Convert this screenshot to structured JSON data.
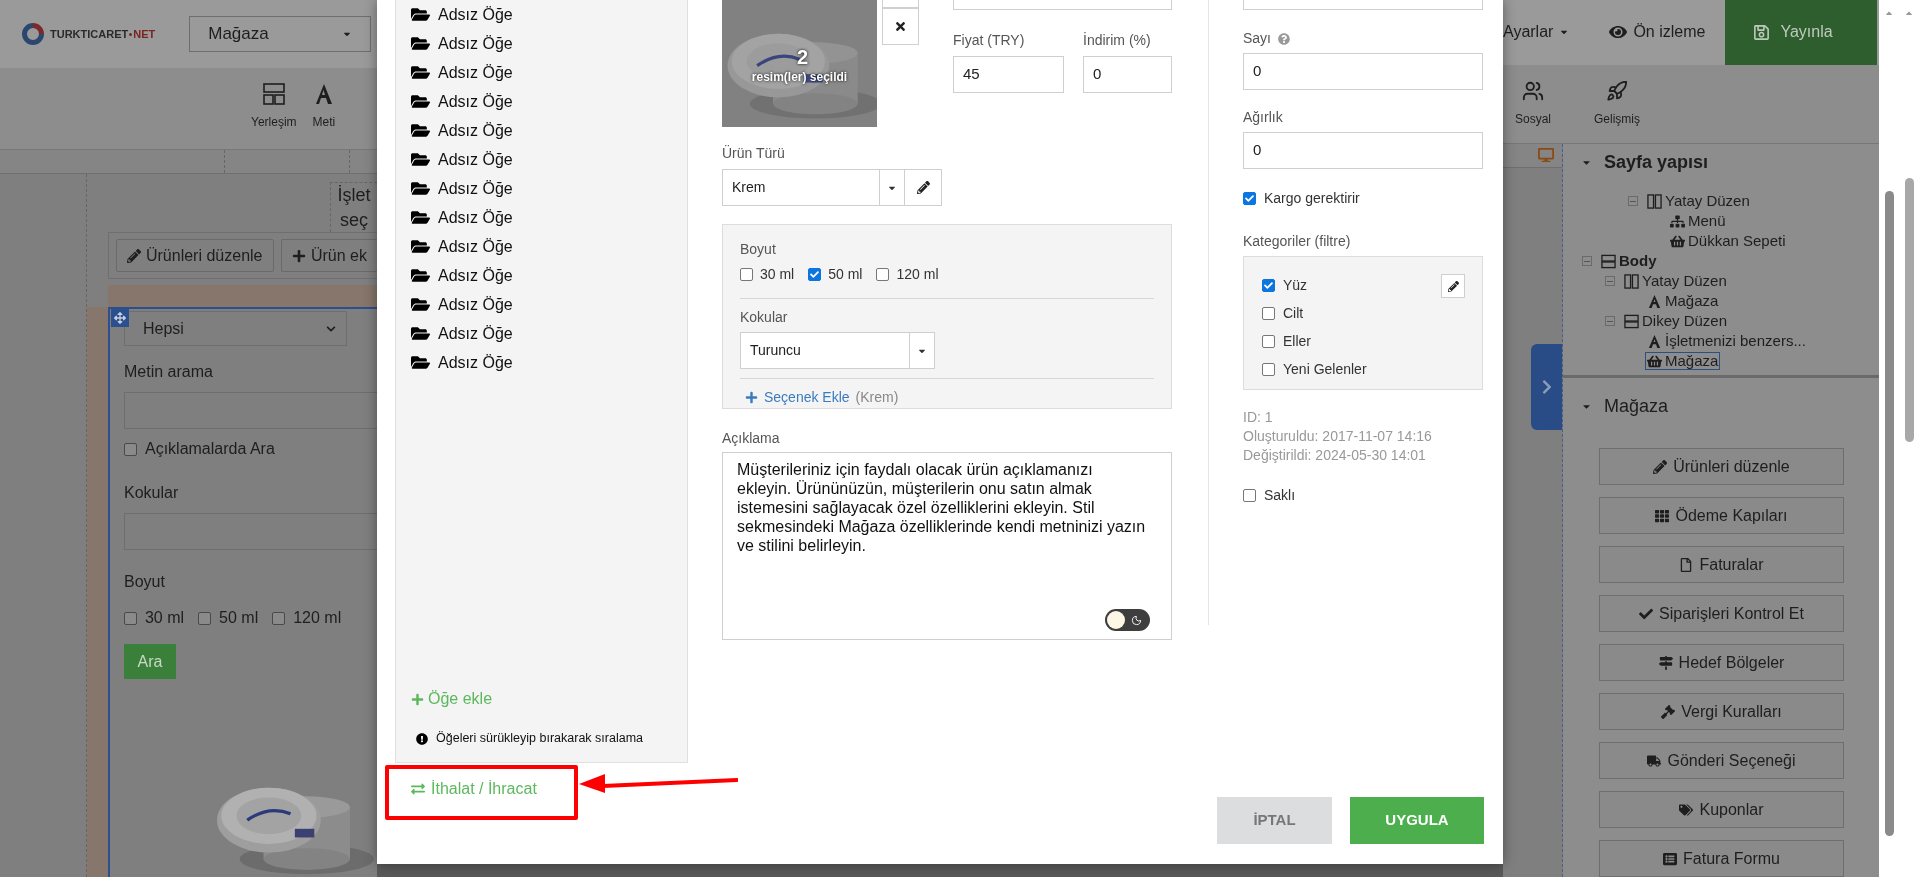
{
  "top_bar": {
    "logo_name": "TURKTICARET",
    "logo_suffix": "NET",
    "page_select": "Mağaza",
    "actions": [
      {
        "label": "Ayarlar",
        "kind": "dropdown"
      },
      {
        "label": "Ön izleme",
        "kind": "preview"
      },
      {
        "label": "Yayınla",
        "kind": "publish"
      }
    ]
  },
  "toolbar_left": [
    {
      "label": "Yerleşim",
      "kind": "layout"
    },
    {
      "label": "Meti",
      "kind": "text"
    }
  ],
  "toolbar_right": [
    {
      "label": "Sosyal",
      "kind": "social"
    },
    {
      "label": "Gelişmiş",
      "kind": "advanced"
    }
  ],
  "canvas": {
    "text_block": [
      "İşlet",
      "seç"
    ],
    "buttons": [
      {
        "label": "Ürünleri düzenle",
        "kind": "edit"
      },
      {
        "label": "Ürün ek",
        "kind": "add"
      }
    ],
    "filter": {
      "category": "Hepsi",
      "search_label": "Metin arama",
      "search_in_descriptions": {
        "label": "Açıklamalarda Ara",
        "checked": false
      },
      "scent_label": "Kokular",
      "size_label": "Boyut",
      "sizes": [
        {
          "label": "30 ml",
          "checked": false
        },
        {
          "label": "50 ml",
          "checked": false
        },
        {
          "label": "120 ml",
          "checked": false
        }
      ],
      "submit": "Ara"
    }
  },
  "modal": {
    "items": [
      {
        "label": "Adsız Öğe"
      },
      {
        "label": "Adsız Öğe"
      },
      {
        "label": "Adsız Öğe"
      },
      {
        "label": "Adsız Öğe"
      },
      {
        "label": "Adsız Öğe"
      },
      {
        "label": "Adsız Öğe"
      },
      {
        "label": "Adsız Öğe"
      },
      {
        "label": "Adsız Öğe"
      },
      {
        "label": "Adsız Öğe"
      },
      {
        "label": "Adsız Öğe"
      },
      {
        "label": "Adsız Öğe"
      },
      {
        "label": "Adsız Öğe"
      },
      {
        "label": "Adsız Öğe"
      }
    ],
    "add_item": "Öğe ekle",
    "sort_hint": "Öğeleri sürükleyip bırakarak sıralama",
    "import_export": "İthalat / İhracat",
    "image": {
      "count": "2",
      "caption": "resim(ler) seçildi"
    },
    "price": {
      "label": "Fiyat (TRY)",
      "value": "45"
    },
    "discount": {
      "label": "İndirim (%)",
      "value": "0"
    },
    "product_type": {
      "label": "Ürün Türü",
      "value": "Krem"
    },
    "options": {
      "size_label": "Boyut",
      "sizes": [
        {
          "label": "30 ml",
          "checked": false
        },
        {
          "label": "50 ml",
          "checked": true
        },
        {
          "label": "120 ml",
          "checked": false
        }
      ],
      "scent_label": "Kokular",
      "scent_value": "Turuncu",
      "add_option": "Seçenek Ekle",
      "add_option_note": "(Krem)"
    },
    "description": {
      "label": "Açıklama",
      "value": "Müşterileriniz için faydalı olacak ürün açıklamanızı ekleyin. Ürününüzün, müşterilerin onu satın almak istemesini sağlayacak özel özelliklerini ekleyin. Stil sekmesindeki Mağaza özelliklerinde kendi metninizi yazın ve stilini belirleyin.",
      "dark_mode": false
    },
    "count": {
      "label": "Sayı",
      "value": "0"
    },
    "weight": {
      "label": "Ağırlık",
      "value": "0"
    },
    "shipping_required": {
      "label": "Kargo gerektirir",
      "checked": true
    },
    "categories": {
      "label": "Kategoriler (filtre)",
      "items": [
        {
          "label": "Yüz",
          "checked": true
        },
        {
          "label": "Cilt",
          "checked": false
        },
        {
          "label": "Eller",
          "checked": false
        },
        {
          "label": "Yeni Gelenler",
          "checked": false
        }
      ]
    },
    "meta": [
      "ID: 1",
      "Oluşturuldu: 2017-11-07 14:16",
      "Değiştirildi: 2024-05-30 14:01"
    ],
    "hidden": {
      "label": "Saklı",
      "checked": false
    },
    "buttons": [
      {
        "label": "İPTAL",
        "kind": "cancel"
      },
      {
        "label": "UYGULA",
        "kind": "apply"
      }
    ]
  },
  "sidebar": {
    "structure_title": "Sayfa yapısı",
    "tree_partial": [
      {
        "label": "Yatay Düzen",
        "kind": "columns",
        "expanded": true,
        "selected": false,
        "children": [
          {
            "label": "Menü",
            "kind": "sitemap",
            "selected": false
          },
          {
            "label": "Dükkan Sepeti",
            "kind": "basket",
            "selected": false
          }
        ]
      }
    ],
    "tree": [
      {
        "label": "Body",
        "kind": "rows",
        "expanded": true,
        "selected": false,
        "children": [
          {
            "label": "Yatay Düzen",
            "kind": "columns",
            "expanded": true,
            "selected": false,
            "children": [
              {
                "label": "Mağaza",
                "kind": "text",
                "selected": false
              }
            ]
          },
          {
            "label": "Dikey Düzen",
            "kind": "rows",
            "expanded": true,
            "selected": false,
            "children": [
              {
                "label": "İşletmenizi benzers...",
                "kind": "text",
                "selected": false
              },
              {
                "label": "Mağaza",
                "kind": "basket",
                "selected": true
              }
            ]
          }
        ]
      }
    ],
    "store_title": "Mağaza",
    "store_buttons": [
      {
        "label": "Ürünleri düzenle",
        "kind": "edit"
      },
      {
        "label": "Ödeme Kapıları",
        "kind": "grid"
      },
      {
        "label": "Faturalar",
        "kind": "file"
      },
      {
        "label": "Siparişleri Kontrol Et",
        "kind": "check"
      },
      {
        "label": "Hedef Bölgeler",
        "kind": "signs"
      },
      {
        "label": "Vergi Kuralları",
        "kind": "gavel"
      },
      {
        "label": "Gönderi Seçeneği",
        "kind": "truck"
      },
      {
        "label": "Kuponlar",
        "kind": "tags"
      },
      {
        "label": "Fatura Formu",
        "kind": "form"
      }
    ]
  }
}
